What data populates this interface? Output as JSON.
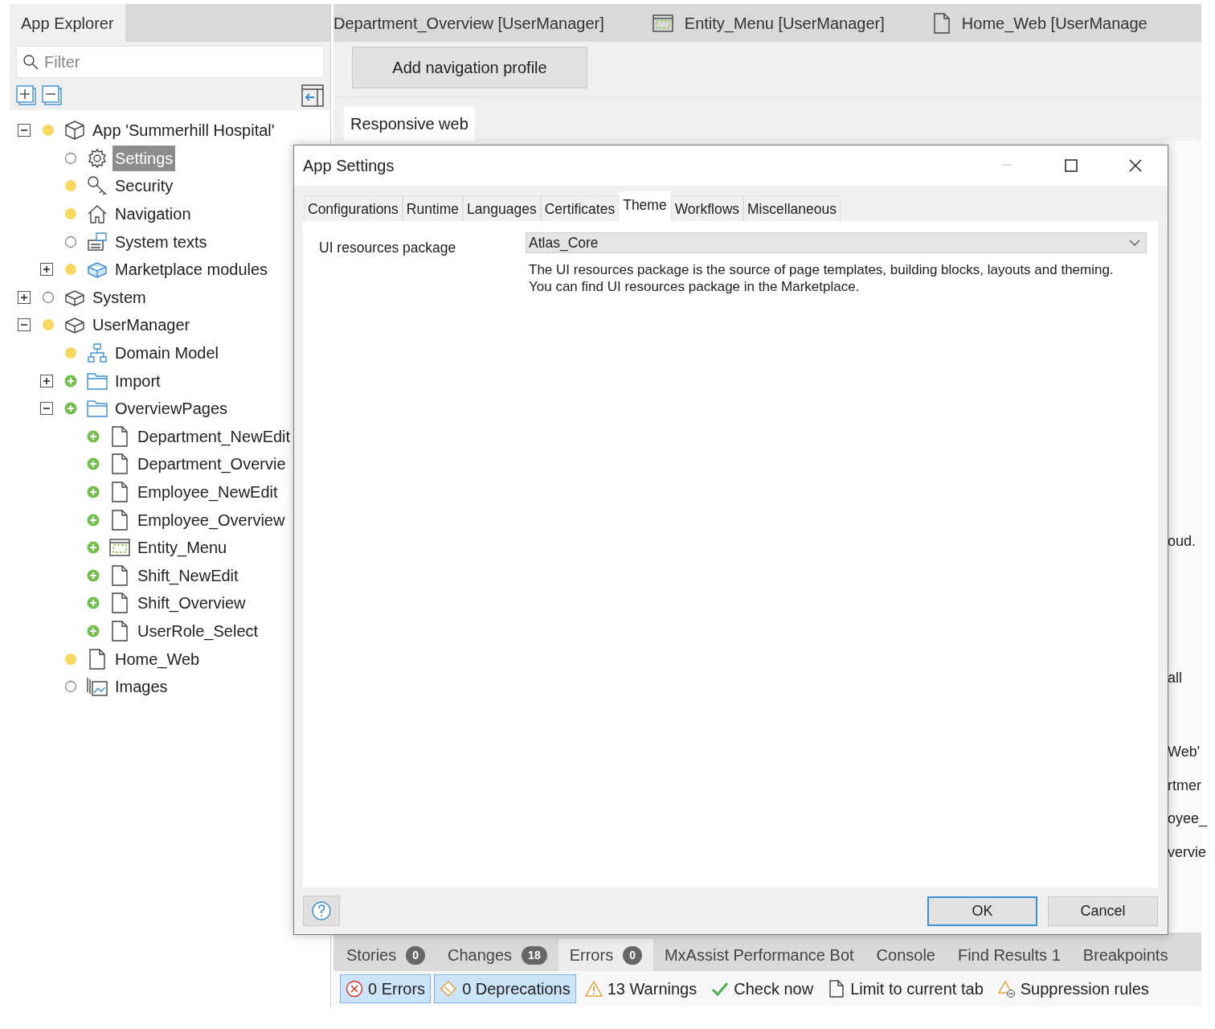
{
  "explorer": {
    "title": "App Explorer",
    "selected": true,
    "filter": {
      "placeholder": "Filter"
    },
    "tree": [
      {
        "label": "App 'Summerhill Hospital'",
        "kind": "app",
        "modified": true,
        "added": false,
        "expanded": true,
        "selected": false,
        "children": [
          {
            "label": "Settings",
            "kind": "settings",
            "modified": false,
            "added": false,
            "selected": true
          },
          {
            "label": "Security",
            "kind": "security",
            "modified": true,
            "added": false,
            "selected": false
          },
          {
            "label": "Navigation",
            "kind": "navigation",
            "modified": true,
            "added": false,
            "selected": false
          },
          {
            "label": "System texts",
            "kind": "system-texts",
            "modified": false,
            "added": false,
            "selected": false
          },
          {
            "label": "Marketplace modules",
            "kind": "marketplace",
            "modified": true,
            "added": false,
            "expanded": false,
            "selected": false
          }
        ]
      },
      {
        "label": "System",
        "kind": "module",
        "modified": false,
        "added": false,
        "expanded": false,
        "selected": false
      },
      {
        "label": "UserManager",
        "kind": "module",
        "modified": true,
        "added": false,
        "expanded": true,
        "selected": false,
        "children": [
          {
            "label": "Domain Model",
            "kind": "domain-model",
            "modified": true,
            "added": false,
            "selected": false
          },
          {
            "label": "Import",
            "kind": "folder",
            "modified": false,
            "added": true,
            "expanded": false,
            "selected": false
          },
          {
            "label": "OverviewPages",
            "kind": "folder",
            "modified": false,
            "added": true,
            "expanded": true,
            "selected": false,
            "children": [
              {
                "label": "Department_NewEdit",
                "kind": "page",
                "modified": false,
                "added": true,
                "selected": false
              },
              {
                "label": "Department_Overvie",
                "kind": "page",
                "modified": false,
                "added": true,
                "selected": false
              },
              {
                "label": "Employee_NewEdit",
                "kind": "page",
                "modified": false,
                "added": true,
                "selected": false
              },
              {
                "label": "Employee_Overview",
                "kind": "page",
                "modified": false,
                "added": true,
                "selected": false
              },
              {
                "label": "Entity_Menu",
                "kind": "snippet",
                "modified": false,
                "added": true,
                "selected": false
              },
              {
                "label": "Shift_NewEdit",
                "kind": "page",
                "modified": false,
                "added": true,
                "selected": false
              },
              {
                "label": "Shift_Overview",
                "kind": "page",
                "modified": false,
                "added": true,
                "selected": false
              },
              {
                "label": "UserRole_Select",
                "kind": "page",
                "modified": false,
                "added": true,
                "selected": false
              }
            ]
          },
          {
            "label": "Home_Web",
            "kind": "page",
            "modified": true,
            "added": false,
            "selected": false
          },
          {
            "label": "Images",
            "kind": "images",
            "modified": false,
            "added": false,
            "selected": false
          }
        ]
      }
    ]
  },
  "document_tabs": [
    {
      "label": "Department_Overview [UserManager]",
      "kind": "plain",
      "selected": false
    },
    {
      "label": "Entity_Menu [UserManager]",
      "kind": "snippet",
      "selected": false
    },
    {
      "label": "Home_Web [UserManage",
      "kind": "page",
      "selected": false
    }
  ],
  "editor": {
    "add_button": "Add navigation profile",
    "profile_tab": "Responsive web",
    "hidden_fragments": [
      "oud.",
      "all",
      "Web'",
      "rtmer",
      "oyee_",
      "vervie"
    ]
  },
  "dialog": {
    "title": "App Settings",
    "tabs": [
      {
        "label": "Configurations",
        "selected": false
      },
      {
        "label": "Runtime",
        "selected": false
      },
      {
        "label": "Languages",
        "selected": false
      },
      {
        "label": "Certificates",
        "selected": false
      },
      {
        "label": "Theme",
        "selected": true
      },
      {
        "label": "Workflows",
        "selected": false
      },
      {
        "label": "Miscellaneous",
        "selected": false
      }
    ],
    "field_label": "UI resources package",
    "field_value": "Atlas_Core",
    "description": "The UI resources package is the source of page templates, building blocks, layouts and theming. You can find UI resources package in the Marketplace.",
    "buttons": [
      {
        "label": "OK",
        "kind": "primary"
      },
      {
        "label": "Cancel",
        "kind": "secondary"
      }
    ]
  },
  "bottom_tabs": [
    {
      "label": "Stories",
      "count": "0",
      "selected": false
    },
    {
      "label": "Changes",
      "count": "18",
      "selected": false
    },
    {
      "label": "Errors",
      "count": "0",
      "selected": true
    },
    {
      "label": "MxAssist Performance Bot",
      "selected": false
    },
    {
      "label": "Console",
      "selected": false
    },
    {
      "label": "Find Results 1",
      "selected": false
    },
    {
      "label": "Breakpoints",
      "selected": false
    }
  ],
  "status_bar": [
    {
      "label": "0 Errors",
      "kind": "error",
      "selected": true
    },
    {
      "label": "0 Deprecations",
      "kind": "deprecation",
      "selected": true
    },
    {
      "label": "13 Warnings",
      "kind": "warning",
      "selected": false
    },
    {
      "label": "Check now",
      "kind": "check",
      "selected": false
    },
    {
      "label": "Limit to current tab",
      "kind": "page",
      "selected": false
    },
    {
      "label": "Suppression rules",
      "kind": "suppression",
      "selected": false
    }
  ]
}
